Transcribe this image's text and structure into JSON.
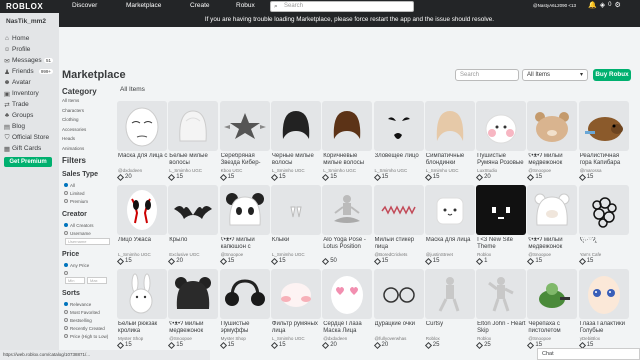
{
  "topbar": {
    "logo": "ROBLOX",
    "nav": [
      "Discover",
      "Marketplace",
      "Create",
      "Robux"
    ],
    "search_placeholder": "Search",
    "username": "@NastyA6L2090 <13",
    "robux_count": "0"
  },
  "banner": "If you are having trouble loading Marketplace, please force restart the app and the issue should resolve.",
  "sidebar": {
    "user": "NasTik_mm2",
    "items": [
      {
        "icon": "home-icon",
        "glyph": "⌂",
        "label": "Home",
        "badge": ""
      },
      {
        "icon": "profile-icon",
        "glyph": "☺",
        "label": "Profile",
        "badge": ""
      },
      {
        "icon": "messages-icon",
        "glyph": "✉",
        "label": "Messages",
        "badge": "51"
      },
      {
        "icon": "friends-icon",
        "glyph": "♟",
        "label": "Friends",
        "badge": "999+"
      },
      {
        "icon": "avatar-icon",
        "glyph": "☻",
        "label": "Avatar",
        "badge": ""
      },
      {
        "icon": "inventory-icon",
        "glyph": "▣",
        "label": "Inventory",
        "badge": ""
      },
      {
        "icon": "trade-icon",
        "glyph": "⇄",
        "label": "Trade",
        "badge": ""
      },
      {
        "icon": "groups-icon",
        "glyph": "♣",
        "label": "Groups",
        "badge": ""
      },
      {
        "icon": "blog-icon",
        "glyph": "▤",
        "label": "Blog",
        "badge": ""
      },
      {
        "icon": "store-icon",
        "glyph": "⛉",
        "label": "Official Store",
        "badge": ""
      },
      {
        "icon": "gift-icon",
        "glyph": "▦",
        "label": "Gift Cards",
        "badge": ""
      }
    ],
    "premium": "Get Premium"
  },
  "marketplace": {
    "title": "Marketplace",
    "search_placeholder": "Search",
    "select_value": "All Items",
    "buy_robux": "Buy Robux",
    "breadcrumb": "All Items"
  },
  "filters": {
    "category_heading": "Category",
    "categories": [
      "All Items",
      "Characters",
      "Clothing",
      "Accessories",
      "Heads",
      "Animations"
    ],
    "filters_heading": "Filters",
    "sales_type_heading": "Sales Type",
    "sales_types": [
      {
        "label": "All",
        "on": true
      },
      {
        "label": "Limited",
        "on": false
      },
      {
        "label": "Premium",
        "on": false
      }
    ],
    "creator_heading": "Creator",
    "creator_options": [
      {
        "label": "All Creators",
        "on": true
      },
      {
        "label": "Username",
        "on": false
      }
    ],
    "creator_placeholder": "Username",
    "price_heading": "Price",
    "price_options": [
      {
        "label": "Any Price",
        "on": true
      },
      {
        "label": "",
        "on": false
      }
    ],
    "price_min": "Min",
    "price_max": "Max",
    "sorts_heading": "Sorts",
    "sorts": [
      {
        "label": "Relevance",
        "on": true
      },
      {
        "label": "Most Favorited",
        "on": false
      },
      {
        "label": "Bestselling",
        "on": false
      },
      {
        "label": "Recently Created",
        "on": false
      },
      {
        "label": "Price (High to Low)",
        "on": false
      }
    ]
  },
  "items": [
    {
      "name": "Маска для лица с",
      "creator": "@dxdxdeen",
      "price": "20",
      "art": "face-mask"
    },
    {
      "name": "Белые милые волосы",
      "creator": "L_Smimho UGC",
      "price": "15",
      "art": "white-hair"
    },
    {
      "name": "Серебряная Звезда Кибер-",
      "creator": "Kboo UGC",
      "price": "15",
      "art": "silver-star"
    },
    {
      "name": "Черные милые волосы",
      "creator": "L_Smimho UGC",
      "price": "15",
      "art": "black-hair"
    },
    {
      "name": "Коричневые милые волосы",
      "creator": "L_Smimho UGC",
      "price": "15",
      "art": "brown-hair"
    },
    {
      "name": "Зловещее Лицо",
      "creator": "L_Smimho UGC",
      "price": "15",
      "art": "sinister-face"
    },
    {
      "name": "Симпатичные блондинки",
      "creator": "L_Smimho UGC",
      "price": "15",
      "art": "blonde-hair"
    },
    {
      "name": "Пушистые Румяна Розовые",
      "creator": "LuxStudio",
      "price": "20",
      "art": "fluffy-blush"
    },
    {
      "name": "ʕ•ᴥ•ʔ милый медвежонок",
      "creator": "@Snoopoe",
      "price": "15",
      "art": "bear-hat"
    },
    {
      "name": "Реалистичная гора Капибара",
      "creator": "@marossa",
      "price": "15",
      "art": "capybara"
    },
    {
      "name": "Лицо Ужаса",
      "creator": "L_Smimho UGC",
      "price": "15",
      "art": "horror-face"
    },
    {
      "name": "Крыло",
      "creator": "Exclusive UGC",
      "price": "20",
      "art": "bat-wing"
    },
    {
      "name": "ʕ•ᴥ•ʔ милый капюшон с",
      "creator": "@Snoopoe",
      "price": "15",
      "art": "panda-hood"
    },
    {
      "name": "Клыки",
      "creator": "L_Smimho UGC",
      "price": "15",
      "art": "fangs"
    },
    {
      "name": "Alo Yoga Pose - Lotus Position",
      "creator": "",
      "price": "50",
      "art": "yoga-pose"
    },
    {
      "name": "Милый стикер лица",
      "creator": "@BoredCrickets",
      "price": "15",
      "art": "face-sticker"
    },
    {
      "name": "Маска для лица",
      "creator": "@justinStreet",
      "price": "15",
      "art": "marshmallow"
    },
    {
      "name": "I <3 New Site Theme",
      "creator": "Roblox",
      "price": "1",
      "art": "new-site"
    },
    {
      "name": "ʕ•ᴥ•ʔ милый медвежонок",
      "creator": "@Snoopoe",
      "price": "15",
      "art": "bear-hood"
    },
    {
      "name": "ʕ̢·͡˔·ོɁ̡̢",
      "creator": "Yan's Cafe",
      "price": "15",
      "art": "curly-hair"
    },
    {
      "name": "Белый рюкзак кролика",
      "creator": "Myster Shop",
      "price": "15",
      "art": "bunny-backpack"
    },
    {
      "name": "ʕ•ᴥ•ʔ милый медвежонок",
      "creator": "@Snoopoe",
      "price": "15",
      "art": "black-bear"
    },
    {
      "name": "Пушистые эрмуффы",
      "creator": "Myster Shop",
      "price": "15",
      "art": "earmuffs"
    },
    {
      "name": "Фильтр румяных лица",
      "creator": "L_Smimho UGC",
      "price": "15",
      "art": "blush-filter"
    },
    {
      "name": "Сердце Глаза Маска Лица",
      "creator": "@dxdxdeen",
      "price": "20",
      "art": "heart-eyes"
    },
    {
      "name": "Дурацкие очки",
      "creator": "@fullyoverwhas",
      "price": "20",
      "art": "glasses"
    },
    {
      "name": "Curtsy",
      "creator": "Roblox",
      "price": "25",
      "art": "curtsy"
    },
    {
      "name": "Elton John - Heart Skip",
      "creator": "Roblox",
      "price": "25",
      "art": "elton"
    },
    {
      "name": "Черепаха с пистолетом",
      "creator": "@Snoopoe",
      "price": "15",
      "art": "turtle"
    },
    {
      "name": "Глаза Галактики Голубые",
      "creator": "yDebiBlox",
      "price": "15",
      "art": "galaxy-eyes"
    }
  ],
  "statusbar": "https://web.roblox.com/catalog/10738871/...",
  "chat": "Chat",
  "colors": {
    "topbar": "#232527",
    "accent": "#00b06f",
    "link": "#0074bd"
  }
}
